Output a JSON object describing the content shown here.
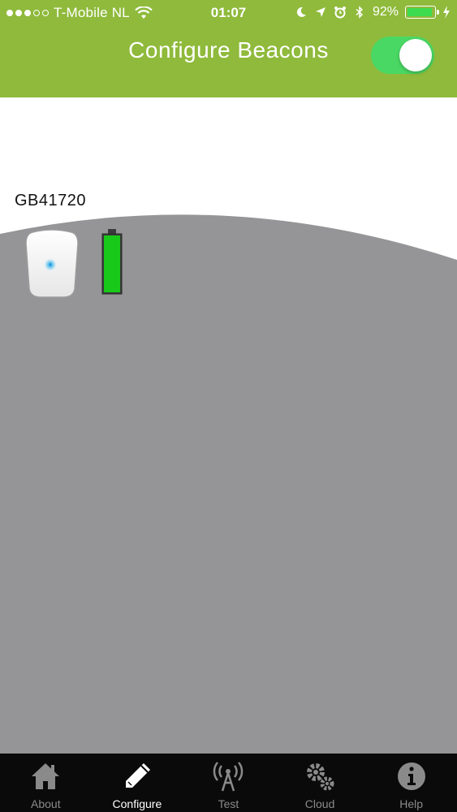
{
  "status_bar": {
    "carrier": "T-Mobile NL",
    "time": "01:07",
    "battery_percent": "92%",
    "signal_bars_filled": 3,
    "signal_bars_total": 5
  },
  "nav": {
    "title": "Configure Beacons",
    "toggle_on": true
  },
  "beacon": {
    "id": "GB41720",
    "battery_level": 1.0
  },
  "tabs": [
    {
      "label": "About",
      "icon": "home-icon",
      "active": false
    },
    {
      "label": "Configure",
      "icon": "pencil-icon",
      "active": true
    },
    {
      "label": "Test",
      "icon": "antenna-icon",
      "active": false
    },
    {
      "label": "Cloud",
      "icon": "gears-icon",
      "active": false
    },
    {
      "label": "Help",
      "icon": "info-icon",
      "active": false
    }
  ],
  "colors": {
    "header": "#8fba3b",
    "toggle": "#4ad864",
    "content_gray": "#959497",
    "battery_green": "#19c919",
    "tabbar": "#0a0a0a"
  }
}
